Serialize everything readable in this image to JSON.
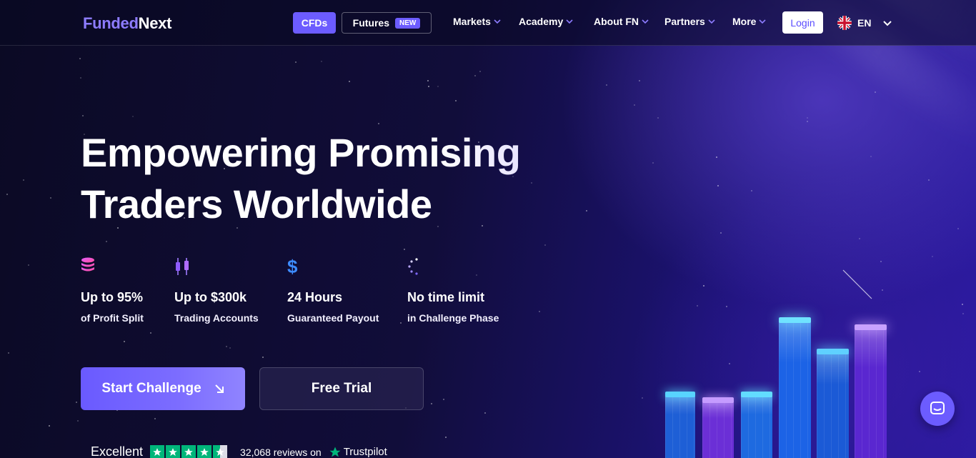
{
  "header": {
    "logo_part1": "Funded",
    "logo_part2": "Next",
    "cfds_label": "CFDs",
    "futures_label": "Futures",
    "futures_badge": "NEW",
    "nav": [
      "Markets",
      "Academy",
      "About FN",
      "Partners",
      "More"
    ],
    "login_label": "Login",
    "language": "EN"
  },
  "hero": {
    "title_line1": "Empowering Promising",
    "title_line2": "Traders Worldwide",
    "features": [
      {
        "icon": "coin-stack-icon",
        "title": "Up to 95%",
        "subtitle": "of Profit Split"
      },
      {
        "icon": "candlestick-icon",
        "title": "Up to $300k",
        "subtitle": "Trading Accounts"
      },
      {
        "icon": "dollar-icon",
        "title": "24 Hours",
        "subtitle": "Guaranteed Payout"
      },
      {
        "icon": "loading-dots-icon",
        "title": "No time limit",
        "subtitle": "in Challenge Phase"
      }
    ],
    "start_label": "Start Challenge",
    "trial_label": "Free Trial"
  },
  "trustpilot": {
    "rating_text": "Excellent",
    "stars": 4.5,
    "reviews": "32,068 reviews on",
    "brand": "Trustpilot"
  },
  "colors": {
    "accent": "#6c5cff",
    "background": "#0c0a2e",
    "trustpilot_green": "#00b67a"
  }
}
